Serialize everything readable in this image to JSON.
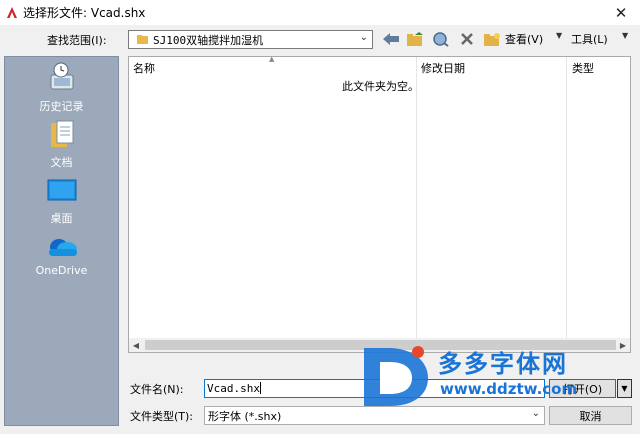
{
  "window": {
    "title": "选择形文件: Vcad.shx",
    "close_glyph": "✕"
  },
  "toolbar": {
    "look_in_label": "查找范围(I):",
    "look_in_value": "SJ100双轴搅拌加湿机",
    "views_label": "查看(V)",
    "tools_label": "工具(L)"
  },
  "places": [
    {
      "label": "历史记录",
      "icon": "history-icon"
    },
    {
      "label": "文档",
      "icon": "documents-icon"
    },
    {
      "label": "桌面",
      "icon": "desktop-icon"
    },
    {
      "label": "OneDrive",
      "icon": "onedrive-icon"
    }
  ],
  "file_list": {
    "columns": [
      "名称",
      "修改日期",
      "类型"
    ],
    "empty_message": "此文件夹为空。"
  },
  "form": {
    "file_name_label": "文件名(N):",
    "file_name_value": "Vcad.shx",
    "file_type_label": "文件类型(T):",
    "file_type_value": "形字体 (*.shx)",
    "open_label": "打开(O)",
    "cancel_label": "取消"
  },
  "watermark": {
    "title": "多多字体网",
    "url": "www.ddztw.com"
  },
  "colors": {
    "places_bg": "#9ba9ba",
    "accent": "#0078d7",
    "watermark": "#1a74d6"
  }
}
